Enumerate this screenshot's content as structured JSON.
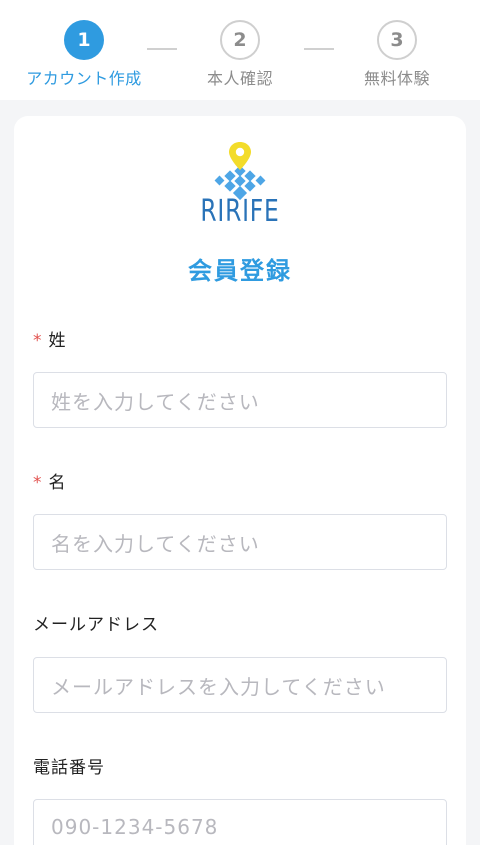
{
  "stepper": {
    "steps": [
      {
        "number": "1",
        "label": "アカウント作成",
        "state": "active"
      },
      {
        "number": "2",
        "label": "本人確認",
        "state": "inactive"
      },
      {
        "number": "3",
        "label": "無料体験",
        "state": "inactive"
      }
    ]
  },
  "colors": {
    "accent": "#2f9be0",
    "required": "#e2524f",
    "logo_pin": "#f3dc2a",
    "logo_blue": "#4ea6e6",
    "logo_text": "#2a73b8"
  },
  "brand": {
    "logo_text": "RIRIFE"
  },
  "form": {
    "title": "会員登録",
    "required_mark": "*",
    "last_name": {
      "label": "姓",
      "placeholder": "姓を入力してください",
      "required": true
    },
    "first_name": {
      "label": "名",
      "placeholder": "名を入力してください",
      "required": true
    },
    "email": {
      "label": "メールアドレス",
      "placeholder": "メールアドレスを入力してください",
      "required": false
    },
    "phone": {
      "label": "電話番号",
      "placeholder": "090-1234-5678",
      "required": false
    }
  }
}
